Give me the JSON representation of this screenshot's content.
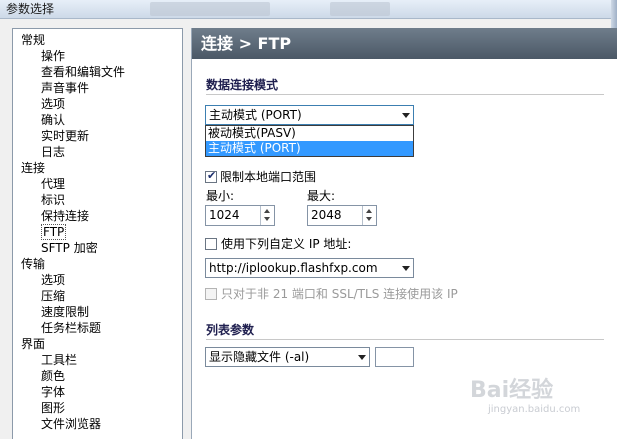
{
  "window": {
    "title": "参数选择"
  },
  "tree": [
    {
      "label": "常规",
      "level": 0
    },
    {
      "label": "操作",
      "level": 1
    },
    {
      "label": "查看和编辑文件",
      "level": 1
    },
    {
      "label": "声音事件",
      "level": 1
    },
    {
      "label": "选项",
      "level": 1
    },
    {
      "label": "确认",
      "level": 1
    },
    {
      "label": "实时更新",
      "level": 1
    },
    {
      "label": "日志",
      "level": 1
    },
    {
      "label": "连接",
      "level": 0
    },
    {
      "label": "代理",
      "level": 1
    },
    {
      "label": "标识",
      "level": 1
    },
    {
      "label": "保持连接",
      "level": 1
    },
    {
      "label": "FTP",
      "level": 1,
      "selected": true
    },
    {
      "label": "SFTP 加密",
      "level": 1
    },
    {
      "label": "传输",
      "level": 0
    },
    {
      "label": "选项",
      "level": 1
    },
    {
      "label": "压缩",
      "level": 1
    },
    {
      "label": "速度限制",
      "level": 1
    },
    {
      "label": "任务栏标题",
      "level": 1
    },
    {
      "label": "界面",
      "level": 0
    },
    {
      "label": "工具栏",
      "level": 1
    },
    {
      "label": "颜色",
      "level": 1
    },
    {
      "label": "字体",
      "level": 1
    },
    {
      "label": "图形",
      "level": 1
    },
    {
      "label": "文件浏览器",
      "level": 1
    }
  ],
  "panel": {
    "header": "连接 > FTP",
    "data_mode": {
      "section": "数据连接模式",
      "selected": "主动模式 (PORT)",
      "options": [
        "被动模式(PASV)",
        "主动模式 (PORT)"
      ],
      "highlighted_index": 1
    },
    "port_range": {
      "checkbox_label": "限制本地端口范围",
      "checked": true,
      "min_label": "最小:",
      "min_value": "1024",
      "max_label": "最大:",
      "max_value": "2048"
    },
    "custom_ip": {
      "checkbox_label": "使用下列自定义 IP 地址:",
      "checked": false,
      "value": "http://iplookup.flashfxp.com",
      "ssl_checkbox_label": "只对于非 21 端口和 SSL/TLS 连接使用该 IP",
      "ssl_checked": false
    },
    "list_params": {
      "section": "列表参数",
      "selected": "显示隐藏文件 (-al)",
      "text_value": ""
    }
  },
  "watermark": {
    "brand": "Bai经验",
    "url": "jingyan.baidu.com"
  }
}
